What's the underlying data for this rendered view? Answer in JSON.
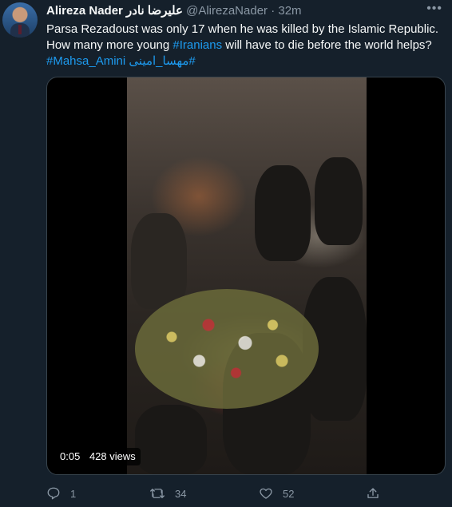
{
  "tweet": {
    "author_name": "Alireza Nader علیرضا نادر",
    "handle": "@AlirezaNader",
    "separator": "·",
    "time": "32m",
    "text_line1": "Parsa Rezadoust was only 17 when he was killed by the Islamic Republic.",
    "text_line2_pre": "How many more young ",
    "hashtag_iranians": "#Iranians",
    "text_line2_post": " will have to die before the world helps?",
    "hashtag_mahsa": "#Mahsa_Amini",
    "hashtag_mahsa_fa": "#مهسا_امینی"
  },
  "video": {
    "duration": "0:05",
    "views": "428 views"
  },
  "actions": {
    "replies": "1",
    "retweets": "34",
    "likes": "52"
  },
  "icons": [
    "more-icon",
    "reply-icon",
    "retweet-icon",
    "like-icon",
    "share-icon"
  ],
  "colors": {
    "background": "#15202b",
    "text": "#f7f9f9",
    "secondary": "#8b98a5",
    "link": "#1d9bf0",
    "border": "#38444d"
  }
}
